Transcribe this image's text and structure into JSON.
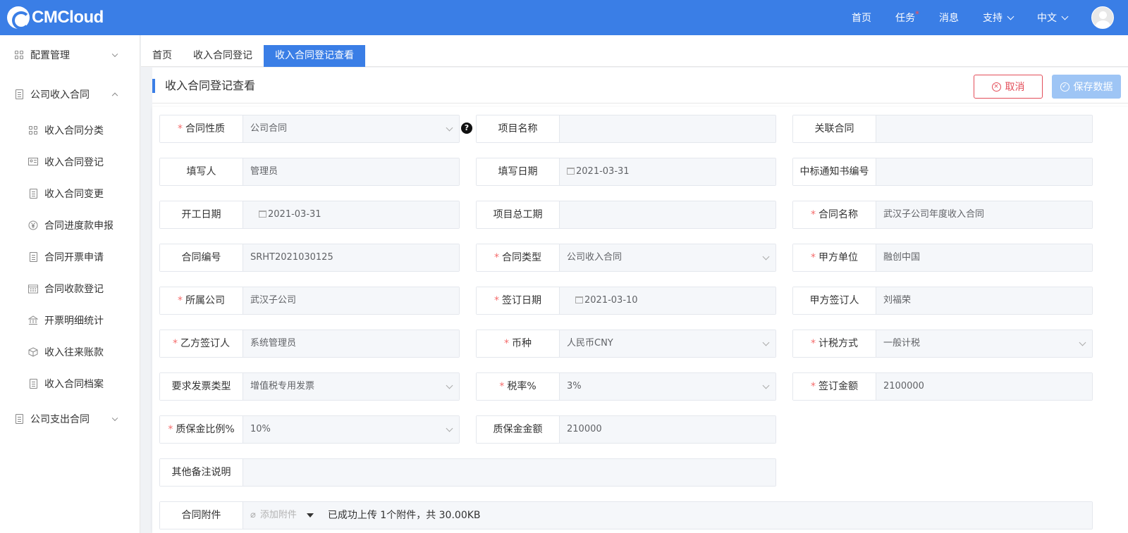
{
  "brand": {
    "name": "CMCloud"
  },
  "topnav": {
    "home": "首页",
    "tasks": "任务",
    "tasks_dot": "*",
    "messages": "消息",
    "support": "支持",
    "language": "中文"
  },
  "sidebar": {
    "groups": [
      {
        "label": "配置管理"
      },
      {
        "label": "公司收入合同"
      },
      {
        "label": "公司支出合同"
      }
    ],
    "items": [
      {
        "label": "收入合同分类"
      },
      {
        "label": "收入合同登记"
      },
      {
        "label": "收入合同变更"
      },
      {
        "label": "合同进度款申报"
      },
      {
        "label": "合同开票申请"
      },
      {
        "label": "合同收款登记"
      },
      {
        "label": "开票明细统计"
      },
      {
        "label": "收入往来账款"
      },
      {
        "label": "收入合同档案"
      }
    ]
  },
  "tabs": [
    {
      "label": "首页"
    },
    {
      "label": "收入合同登记"
    },
    {
      "label": "收入合同登记查看"
    }
  ],
  "page": {
    "title": "收入合同登记查看",
    "cancel": "取消",
    "save": "保存数据",
    "required_mark": "*"
  },
  "form": {
    "contract_nature": {
      "label": "合同性质",
      "value": "公司合同"
    },
    "project_name": {
      "label": "项目名称",
      "value": ""
    },
    "related_contract": {
      "label": "关联合同",
      "value": ""
    },
    "filler": {
      "label": "填写人",
      "value": "管理员"
    },
    "fill_date": {
      "label": "填写日期",
      "value": "2021-03-31"
    },
    "bid_notice_no": {
      "label": "中标通知书编号",
      "value": ""
    },
    "start_date": {
      "label": "开工日期",
      "value": "2021-03-31"
    },
    "total_duration": {
      "label": "项目总工期",
      "value": ""
    },
    "contract_name": {
      "label": "合同名称",
      "value": "武汉子公司年度收入合同"
    },
    "contract_no": {
      "label": "合同编号",
      "value": "SRHT2021030125"
    },
    "contract_type": {
      "label": "合同类型",
      "value": "公司收入合同"
    },
    "party_a": {
      "label": "甲方单位",
      "value": "融创中国"
    },
    "company": {
      "label": "所属公司",
      "value": "武汉子公司"
    },
    "sign_date": {
      "label": "签订日期",
      "value": "2021-03-10"
    },
    "party_a_signer": {
      "label": "甲方签订人",
      "value": "刘福荣"
    },
    "party_b_signer": {
      "label": "乙方签订人",
      "value": "系统管理员"
    },
    "currency": {
      "label": "币种",
      "value": "人民币CNY"
    },
    "tax_method": {
      "label": "计税方式",
      "value": "一般计税"
    },
    "invoice_type": {
      "label": "要求发票类型",
      "value": "增值税专用发票"
    },
    "tax_rate": {
      "label": "税率%",
      "value": "3%"
    },
    "sign_amount": {
      "label": "签订金额",
      "value": "2100000"
    },
    "warranty_ratio": {
      "label": "质保金比例%",
      "value": "10%"
    },
    "warranty_amount": {
      "label": "质保金金额",
      "value": "210000"
    },
    "remarks": {
      "label": "其他备注说明",
      "value": ""
    },
    "attachment": {
      "label": "合同附件",
      "add": "添加附件",
      "status": "已成功上传 1个附件，共 30.00KB"
    }
  },
  "help_glyph": "?",
  "colors": {
    "primary": "#3a7ee6",
    "danger": "#e34d59",
    "required": "#f56c6c",
    "save_disabled": "#9ec5f5"
  }
}
